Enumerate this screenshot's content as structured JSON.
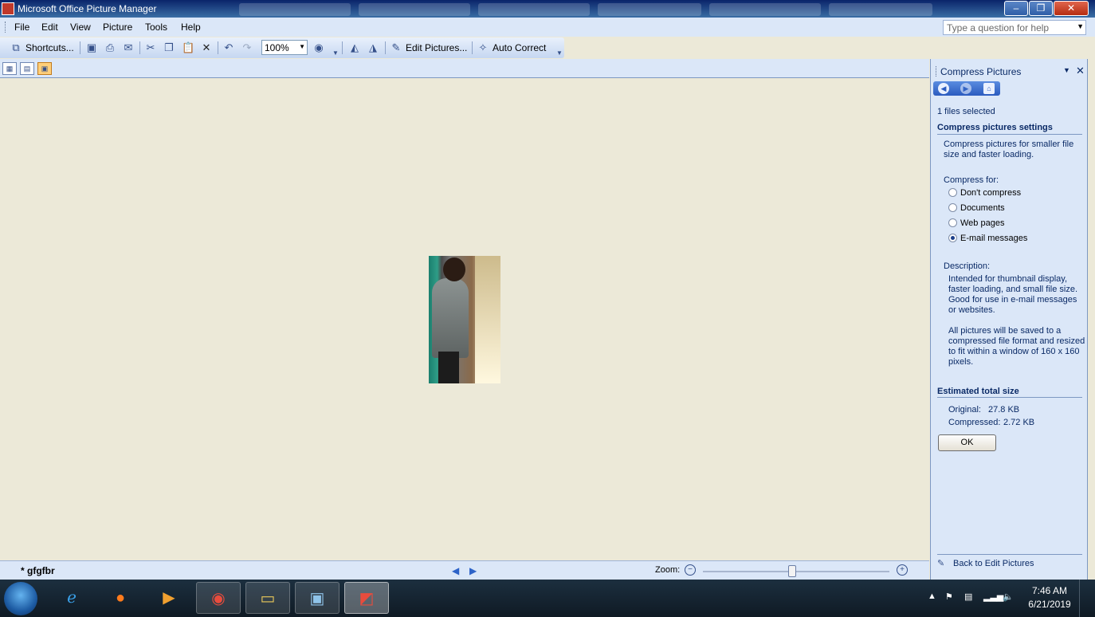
{
  "window": {
    "title": "Microsoft Office Picture Manager",
    "controls": {
      "minimize": "–",
      "maximize": "❐",
      "close": "✕"
    }
  },
  "menu": {
    "items": [
      "File",
      "Edit",
      "View",
      "Picture",
      "Tools",
      "Help"
    ],
    "help_placeholder": "Type a question for help"
  },
  "toolbar": {
    "shortcuts_label": "Shortcuts...",
    "zoom_value": "100%",
    "edit_pictures_label": "Edit Pictures...",
    "auto_correct_label": "Auto Correct"
  },
  "status": {
    "filename": "* gfgfbr",
    "zoom_label": "Zoom:"
  },
  "task_pane": {
    "title": "Compress Pictures",
    "files_selected": "1 files selected",
    "settings_heading": "Compress pictures settings",
    "settings_desc": "Compress pictures for smaller file size and faster loading.",
    "compress_for_label": "Compress for:",
    "options": [
      {
        "label": "Don't compress",
        "selected": false
      },
      {
        "label": "Documents",
        "selected": false
      },
      {
        "label": "Web pages",
        "selected": false
      },
      {
        "label": "E-mail messages",
        "selected": true
      }
    ],
    "description_label": "Description:",
    "description_1": "Intended for thumbnail display, faster loading, and small file size. Good for use in e-mail messages or websites.",
    "description_2": "All pictures will be saved to a compressed file format and resized to fit within a window of 160 x 160 pixels.",
    "size_heading": "Estimated total size",
    "original_label": "Original:",
    "original_value": "27.8 KB",
    "compressed_label": "Compressed:",
    "compressed_value": "2.72 KB",
    "ok_label": "OK",
    "back_link": "Back to Edit Pictures"
  },
  "taskbar": {
    "time": "7:46 AM",
    "date": "6/21/2019"
  },
  "zoom_slider_level": 0.48
}
